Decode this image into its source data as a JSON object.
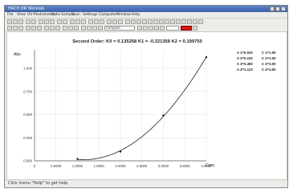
{
  "window": {
    "title": "HACH DR Worklab"
  },
  "menu": [
    "File",
    "View",
    "UV-Photometric",
    "Auto-Sample",
    "Scan",
    "Settings",
    "Computer",
    "Window",
    "Help"
  ],
  "toolbar": {
    "combo_value": "Compact",
    "accent_color": "#d51616"
  },
  "chart_data": {
    "type": "line",
    "title": "Second Order:  K0 = 0.135258  K1 = -0.321358  K2 = 0.199750",
    "ylabel": "Abs",
    "xlabel": "Conc",
    "x_ticks": [
      "0",
      "0.5000",
      "1.0000",
      "1.5000",
      "2.0000",
      "2.5000",
      "3.0000",
      "3.5000",
      "4.0000"
    ],
    "y_ticks": [
      "0.000",
      "0.250",
      "0.500",
      "0.750",
      "1.000"
    ],
    "xlim": [
      0,
      4
    ],
    "ylim": [
      0,
      1.2
    ],
    "points": [
      {
        "x": 1.0,
        "y": 0.02
      },
      {
        "x": 2.0,
        "y": 0.1
      },
      {
        "x": 3.0,
        "y": 0.49
      },
      {
        "x": 4.0,
        "y": 1.12
      }
    ],
    "curve": {
      "k0": 0.135258,
      "k1": -0.321358,
      "k2": 0.19975
    },
    "grid": true
  },
  "legend": {
    "abs": [
      "A 1=0.020",
      "A 2=0.100",
      "A 3=0.490",
      "A 4=1.123"
    ],
    "conc": [
      "C 1=1.00",
      "C 2=2.00",
      "C 3=3.00",
      "C 4=4.00"
    ]
  },
  "status": {
    "text": "Click menu \"Help\" to get help"
  }
}
